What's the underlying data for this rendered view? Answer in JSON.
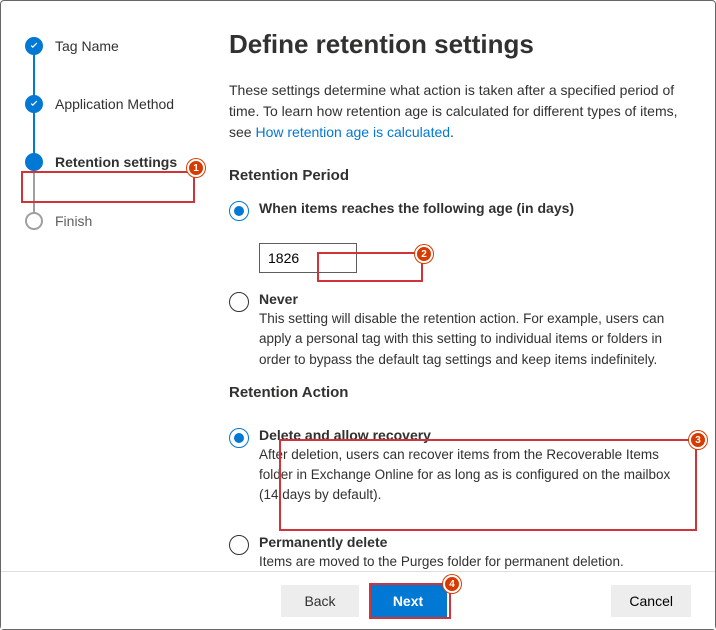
{
  "sidebar": {
    "steps": [
      {
        "label": "Tag Name"
      },
      {
        "label": "Application Method"
      },
      {
        "label": "Retention settings"
      },
      {
        "label": "Finish"
      }
    ]
  },
  "main": {
    "title": "Define retention settings",
    "intro_prefix": "These settings determine what action is taken after a specified period of time. To learn how retention age is calculated for different types of items, see ",
    "intro_link": "How retention age is calculated",
    "intro_suffix": ".",
    "retention_period": {
      "heading": "Retention Period",
      "when_label": "When items reaches the following age (in days)",
      "when_value": "1826",
      "never_label": "Never",
      "never_desc": "This setting will disable the retention action. For example, users can apply a personal tag with this setting to individual items or folders in order to bypass the default tag settings and keep items indefinitely."
    },
    "retention_action": {
      "heading": "Retention Action",
      "delete_label": "Delete and allow recovery",
      "delete_desc": "After deletion, users can recover items from the Recoverable Items folder in Exchange Online for as long as is configured on the mailbox (14 days by default).",
      "perm_label": "Permanently delete",
      "perm_desc": "Items are moved to the Purges folder for permanent deletion."
    }
  },
  "footer": {
    "back": "Back",
    "next": "Next",
    "cancel": "Cancel"
  },
  "annotations": {
    "n1": "1",
    "n2": "2",
    "n3": "3",
    "n4": "4"
  }
}
